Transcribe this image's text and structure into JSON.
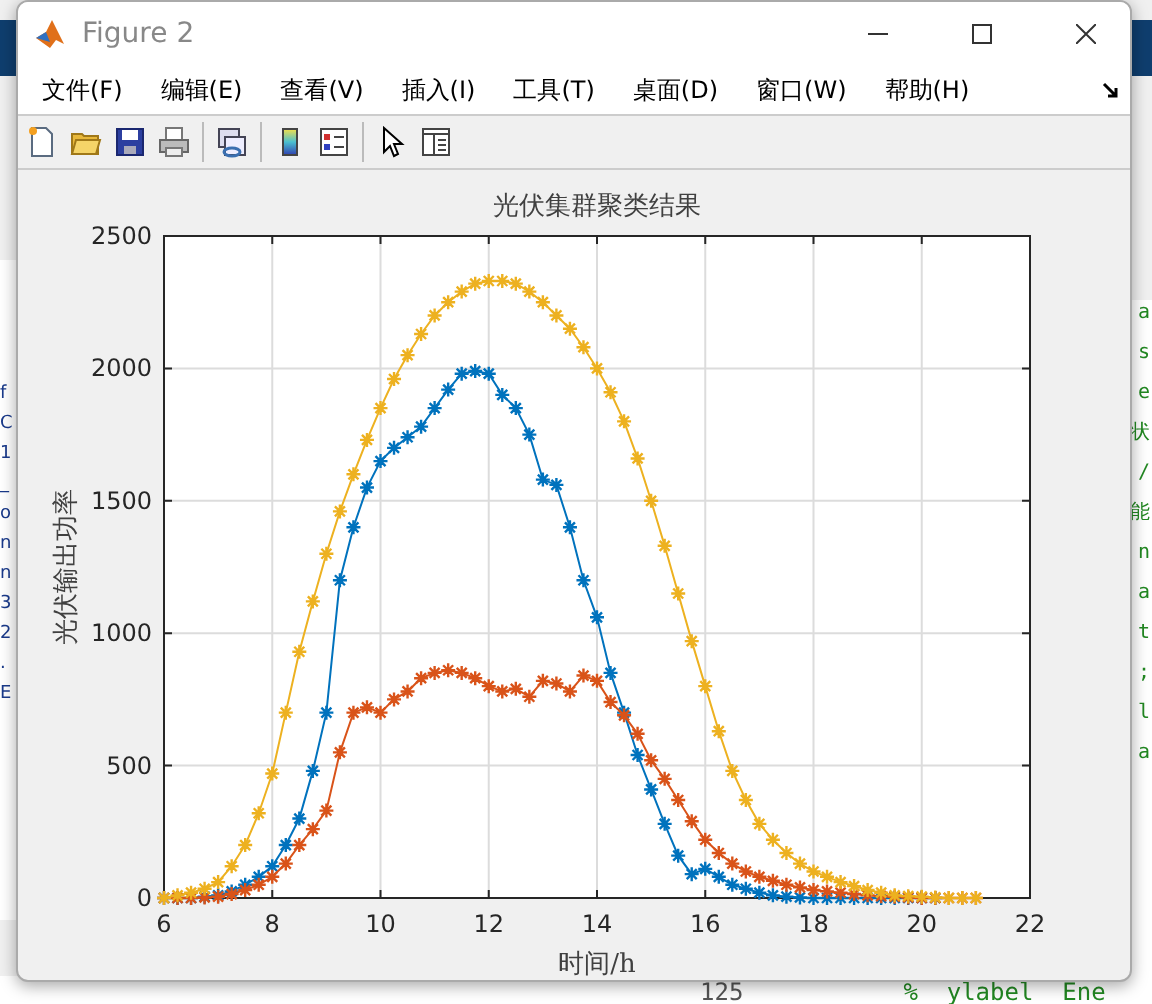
{
  "background": {
    "left_fragments": [
      "f",
      "C",
      "1",
      "_",
      "o",
      "n",
      "n",
      "3",
      "2",
      ".",
      "E"
    ],
    "right_fragments": [
      "a",
      "s",
      "e",
      "状",
      "/",
      "能",
      "n",
      "a",
      "t",
      ";",
      "l",
      "a"
    ],
    "bottom_line_number": "125",
    "bottom_code": "%  ylabel  Ene"
  },
  "window": {
    "title": "Figure 2"
  },
  "menu": [
    {
      "label": "文件(F)"
    },
    {
      "label": "编辑(E)"
    },
    {
      "label": "查看(V)"
    },
    {
      "label": "插入(I)"
    },
    {
      "label": "工具(T)"
    },
    {
      "label": "桌面(D)"
    },
    {
      "label": "窗口(W)"
    },
    {
      "label": "帮助(H)"
    }
  ],
  "toolbar": [
    {
      "kind": "new"
    },
    {
      "kind": "open"
    },
    {
      "kind": "save"
    },
    {
      "kind": "print"
    },
    {
      "kind": "sep"
    },
    {
      "kind": "link"
    },
    {
      "kind": "sep"
    },
    {
      "kind": "colorbar"
    },
    {
      "kind": "legend"
    },
    {
      "kind": "sep"
    },
    {
      "kind": "pointer"
    },
    {
      "kind": "inspector"
    }
  ],
  "chart_data": {
    "type": "line",
    "title": "光伏集群聚类结果",
    "xlabel": "时间/h",
    "ylabel": "光伏输出功率",
    "x": [
      6,
      6.25,
      6.5,
      6.75,
      7,
      7.25,
      7.5,
      7.75,
      8,
      8.25,
      8.5,
      8.75,
      9,
      9.25,
      9.5,
      9.75,
      10,
      10.25,
      10.5,
      10.75,
      11,
      11.25,
      11.5,
      11.75,
      12,
      12.25,
      12.5,
      12.75,
      13,
      13.25,
      13.5,
      13.75,
      14,
      14.25,
      14.5,
      14.75,
      15,
      15.25,
      15.5,
      15.75,
      16,
      16.25,
      16.5,
      16.75,
      17,
      17.25,
      17.5,
      17.75,
      18,
      18.25,
      18.5,
      18.75,
      19,
      19.25,
      19.5,
      19.75,
      20,
      20.25,
      20.5,
      20.75,
      21
    ],
    "series": [
      {
        "color": "#0072bd",
        "marker": "cross",
        "values": [
          0,
          0,
          0,
          5,
          10,
          25,
          50,
          80,
          120,
          200,
          300,
          480,
          700,
          1200,
          1400,
          1550,
          1650,
          1700,
          1740,
          1780,
          1850,
          1920,
          1980,
          1990,
          1980,
          1900,
          1850,
          1750,
          1580,
          1560,
          1400,
          1200,
          1060,
          850,
          700,
          540,
          410,
          280,
          160,
          90,
          110,
          80,
          50,
          35,
          20,
          10,
          5,
          2,
          0,
          0,
          0,
          0,
          0,
          0,
          0,
          0,
          0,
          0,
          null,
          null,
          null
        ]
      },
      {
        "color": "#d95319",
        "marker": "cross",
        "values": [
          0,
          0,
          0,
          2,
          5,
          15,
          30,
          50,
          80,
          130,
          200,
          260,
          330,
          550,
          700,
          720,
          700,
          750,
          780,
          830,
          850,
          860,
          850,
          830,
          800,
          780,
          790,
          760,
          820,
          810,
          780,
          840,
          820,
          740,
          690,
          620,
          520,
          450,
          370,
          290,
          220,
          170,
          130,
          100,
          80,
          65,
          50,
          40,
          30,
          25,
          20,
          15,
          10,
          7,
          5,
          2,
          0,
          0,
          0,
          0,
          0
        ]
      },
      {
        "color": "#edb120",
        "marker": "cross",
        "values": [
          0,
          10,
          20,
          35,
          60,
          120,
          200,
          320,
          470,
          700,
          930,
          1120,
          1300,
          1460,
          1600,
          1730,
          1850,
          1960,
          2050,
          2130,
          2200,
          2250,
          2290,
          2320,
          2330,
          2330,
          2320,
          2290,
          2250,
          2200,
          2150,
          2080,
          2000,
          1910,
          1800,
          1660,
          1500,
          1330,
          1150,
          970,
          800,
          630,
          480,
          370,
          280,
          220,
          170,
          130,
          100,
          80,
          60,
          45,
          30,
          20,
          10,
          7,
          5,
          2,
          0,
          0,
          0
        ]
      }
    ],
    "grid": true,
    "xlim": [
      6,
      22
    ],
    "ylim": [
      0,
      2500
    ],
    "xticks": [
      6,
      8,
      10,
      12,
      14,
      16,
      18,
      20,
      22
    ],
    "yticks": [
      0,
      500,
      1000,
      1500,
      2000,
      2500
    ]
  }
}
